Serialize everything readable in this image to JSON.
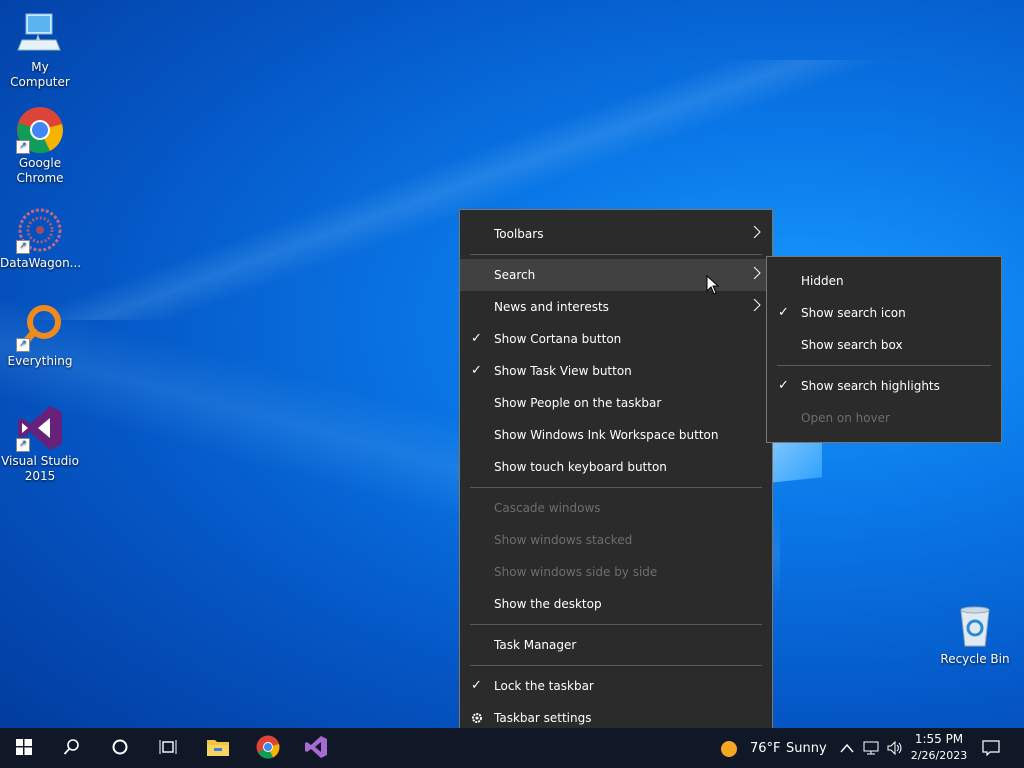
{
  "desktop": {
    "icons": [
      {
        "label": "My Computer",
        "icon": "computer-icon"
      },
      {
        "label": "Google Chrome",
        "icon": "chrome-icon"
      },
      {
        "label": "DataWagon...",
        "icon": "datawagon-icon"
      },
      {
        "label": "Everything",
        "icon": "everything-search-icon"
      },
      {
        "label": "Visual Studio 2015",
        "icon": "visual-studio-icon"
      },
      {
        "label": "Recycle Bin",
        "icon": "recycle-bin-icon"
      }
    ]
  },
  "context_menu": {
    "items": [
      {
        "label": "Toolbars",
        "submenu": true
      },
      {
        "label": "Search",
        "submenu": true,
        "highlighted": true
      },
      {
        "label": "News and interests",
        "submenu": true
      },
      {
        "label": "Show Cortana button",
        "checked": true
      },
      {
        "label": "Show Task View button",
        "checked": true
      },
      {
        "label": "Show People on the taskbar"
      },
      {
        "label": "Show Windows Ink Workspace button"
      },
      {
        "label": "Show touch keyboard button"
      },
      {
        "label": "Cascade windows",
        "disabled": true
      },
      {
        "label": "Show windows stacked",
        "disabled": true
      },
      {
        "label": "Show windows side by side",
        "disabled": true
      },
      {
        "label": "Show the desktop"
      },
      {
        "label": "Task Manager"
      },
      {
        "label": "Lock the taskbar",
        "checked": true
      },
      {
        "label": "Taskbar settings",
        "icon": "gear-icon"
      }
    ]
  },
  "search_submenu": {
    "items": [
      {
        "label": "Hidden"
      },
      {
        "label": "Show search icon",
        "checked": true
      },
      {
        "label": "Show search box"
      },
      {
        "label": "Show search highlights",
        "checked": true
      },
      {
        "label": "Open on hover",
        "disabled": true
      }
    ]
  },
  "taskbar": {
    "pinned": [
      "start-icon",
      "search-icon",
      "cortana-icon",
      "task-view-icon",
      "file-explorer-icon",
      "chrome-icon",
      "visual-studio-icon"
    ],
    "weather": {
      "temp": "76°F",
      "condition": "Sunny"
    },
    "time": "1:55 PM",
    "date": "2/26/2023"
  },
  "colors": {
    "menu_bg": "#2b2b2b",
    "taskbar_bg": "#101828",
    "desktop_accent": "#0a78e8"
  }
}
